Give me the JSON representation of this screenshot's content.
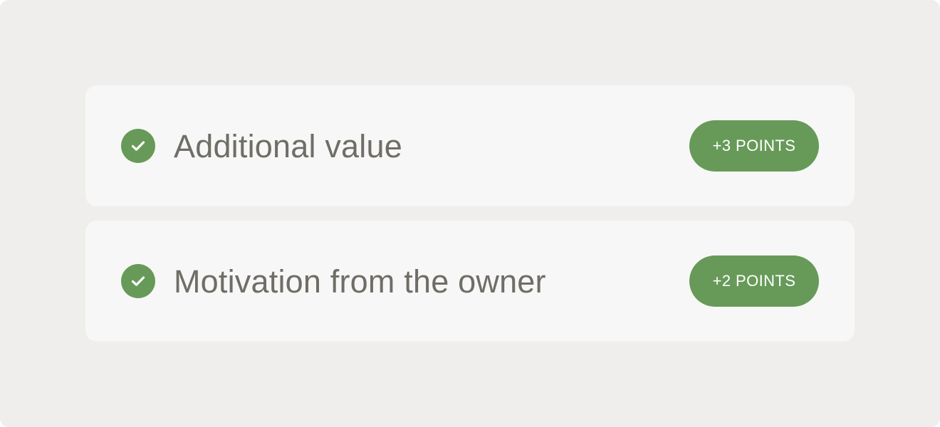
{
  "colors": {
    "background": "#efeeec",
    "card": "#f7f7f7",
    "accent_green": "#679a58",
    "text": "#6f6d66",
    "badge_text": "#ffffff"
  },
  "items": [
    {
      "icon": "check-circle-icon",
      "title": "Additional value",
      "points_label": "+3 POINTS"
    },
    {
      "icon": "check-circle-icon",
      "title": "Motivation from the owner",
      "points_label": "+2 POINTS"
    }
  ]
}
